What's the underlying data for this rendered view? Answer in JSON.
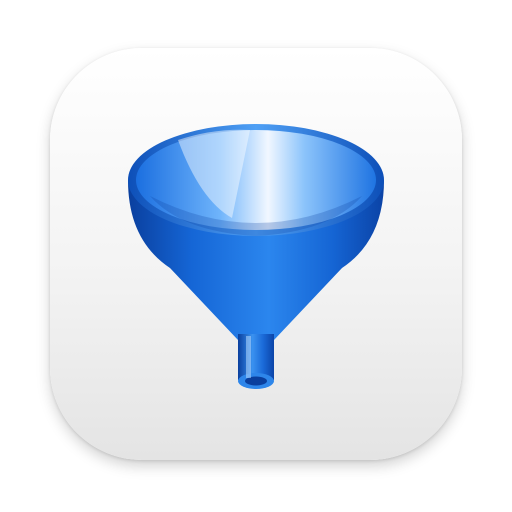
{
  "app_icon": {
    "icon_name": "funnel-icon",
    "colors": {
      "tile_top": "#ffffff",
      "tile_bottom": "#e4e4e4",
      "funnel_dark": "#0a3f9e",
      "funnel_mid": "#1566d6",
      "funnel_light": "#5aa7f5",
      "highlight": "#e8f3ff"
    }
  }
}
